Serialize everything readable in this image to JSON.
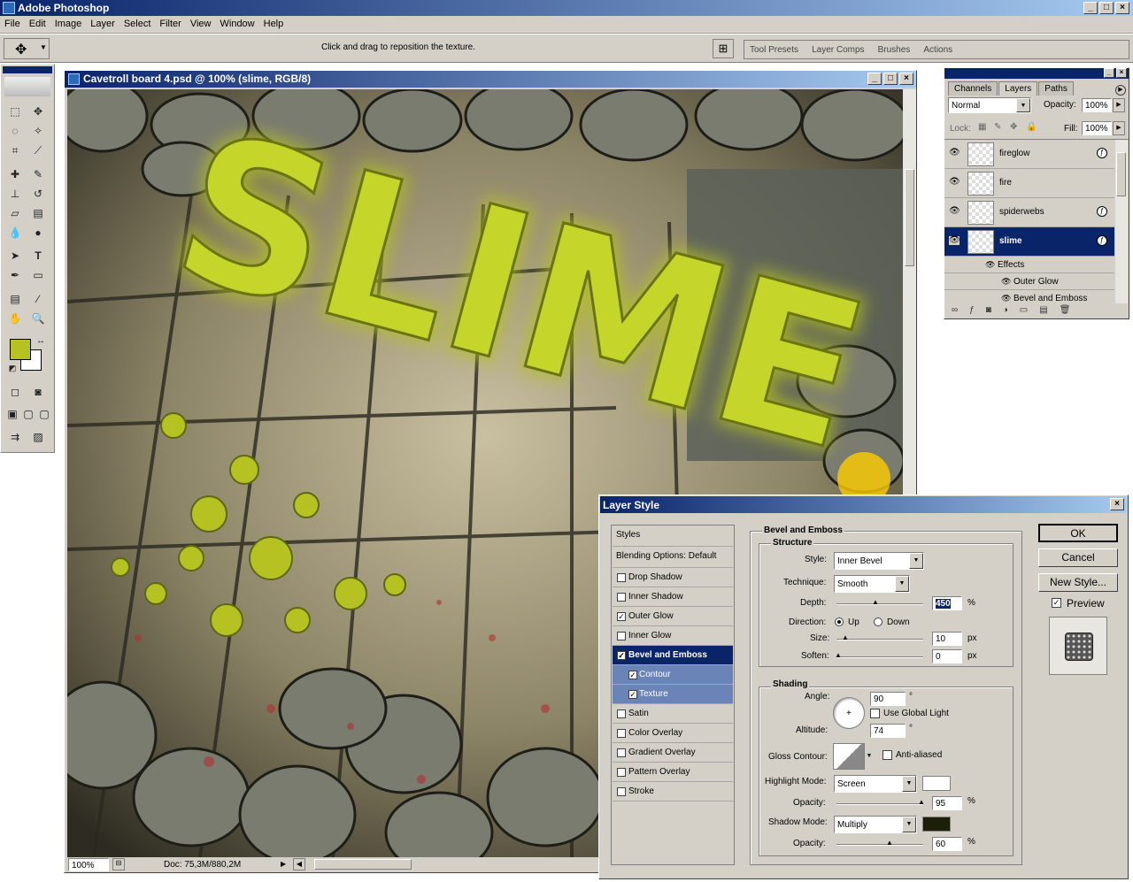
{
  "app": {
    "title": "Adobe Photoshop",
    "min": "_",
    "max": "□",
    "close": "×"
  },
  "menu": [
    "File",
    "Edit",
    "Image",
    "Layer",
    "Select",
    "Filter",
    "View",
    "Window",
    "Help"
  ],
  "options": {
    "hint": "Click and drag to reposition the texture.",
    "palette_tabs": [
      "Tool Presets",
      "Layer Comps",
      "Brushes",
      "Actions"
    ]
  },
  "colors": {
    "foreground": "#b5c221",
    "background": "#ffffff",
    "highlight_swatch": "#ffffff",
    "shadow_swatch": "#1c2008",
    "slime": "#c6d52a"
  },
  "document": {
    "title": "Cavetroll board 4.psd @ 100% (slime, RGB/8)",
    "zoom": "100%",
    "doc_info": "Doc: 75,3M/880,2M",
    "canvas_text": "SLIME"
  },
  "layers_panel": {
    "tabs": [
      "Channels",
      "Layers",
      "Paths"
    ],
    "blend_mode": "Normal",
    "opacity_label": "Opacity:",
    "opacity": "100%",
    "lock_label": "Lock:",
    "fill_label": "Fill:",
    "fill": "100%",
    "layers": [
      {
        "name": "fireglow",
        "fx": true
      },
      {
        "name": "fire",
        "fx": false
      },
      {
        "name": "spiderwebs",
        "fx": true
      },
      {
        "name": "slime",
        "fx": true,
        "selected": true
      }
    ],
    "effects_label": "Effects",
    "effects": [
      "Outer Glow",
      "Bevel and Emboss"
    ]
  },
  "layer_style": {
    "title": "Layer Style",
    "styles_header": "Styles",
    "blending": "Blending Options: Default",
    "items": [
      {
        "label": "Drop Shadow",
        "checked": false
      },
      {
        "label": "Inner Shadow",
        "checked": false
      },
      {
        "label": "Outer Glow",
        "checked": true
      },
      {
        "label": "Inner Glow",
        "checked": false
      },
      {
        "label": "Bevel and Emboss",
        "checked": true,
        "selected": true
      },
      {
        "label": "Contour",
        "checked": true,
        "sub": true
      },
      {
        "label": "Texture",
        "checked": true,
        "sub": true
      },
      {
        "label": "Satin",
        "checked": false
      },
      {
        "label": "Color Overlay",
        "checked": false
      },
      {
        "label": "Gradient Overlay",
        "checked": false
      },
      {
        "label": "Pattern Overlay",
        "checked": false
      },
      {
        "label": "Stroke",
        "checked": false
      }
    ],
    "section_title": "Bevel and Emboss",
    "structure": {
      "title": "Structure",
      "style_label": "Style:",
      "style": "Inner Bevel",
      "technique_label": "Technique:",
      "technique": "Smooth",
      "depth_label": "Depth:",
      "depth": "450",
      "direction_label": "Direction:",
      "dir_up": "Up",
      "dir_down": "Down",
      "size_label": "Size:",
      "size": "10",
      "soften_label": "Soften:",
      "soften": "0",
      "pct": "%",
      "px": "px"
    },
    "shading": {
      "title": "Shading",
      "angle_label": "Angle:",
      "angle": "90",
      "deg": "°",
      "global_light": "Use Global Light",
      "altitude_label": "Altitude:",
      "altitude": "74",
      "gloss_label": "Gloss Contour:",
      "anti_aliased": "Anti-aliased",
      "highlight_mode_label": "Highlight Mode:",
      "highlight_mode": "Screen",
      "opacity_label": "Opacity:",
      "highlight_opacity": "95",
      "shadow_mode_label": "Shadow Mode:",
      "shadow_mode": "Multiply",
      "shadow_opacity": "60"
    },
    "buttons": {
      "ok": "OK",
      "cancel": "Cancel",
      "new_style": "New Style...",
      "preview": "Preview"
    }
  }
}
